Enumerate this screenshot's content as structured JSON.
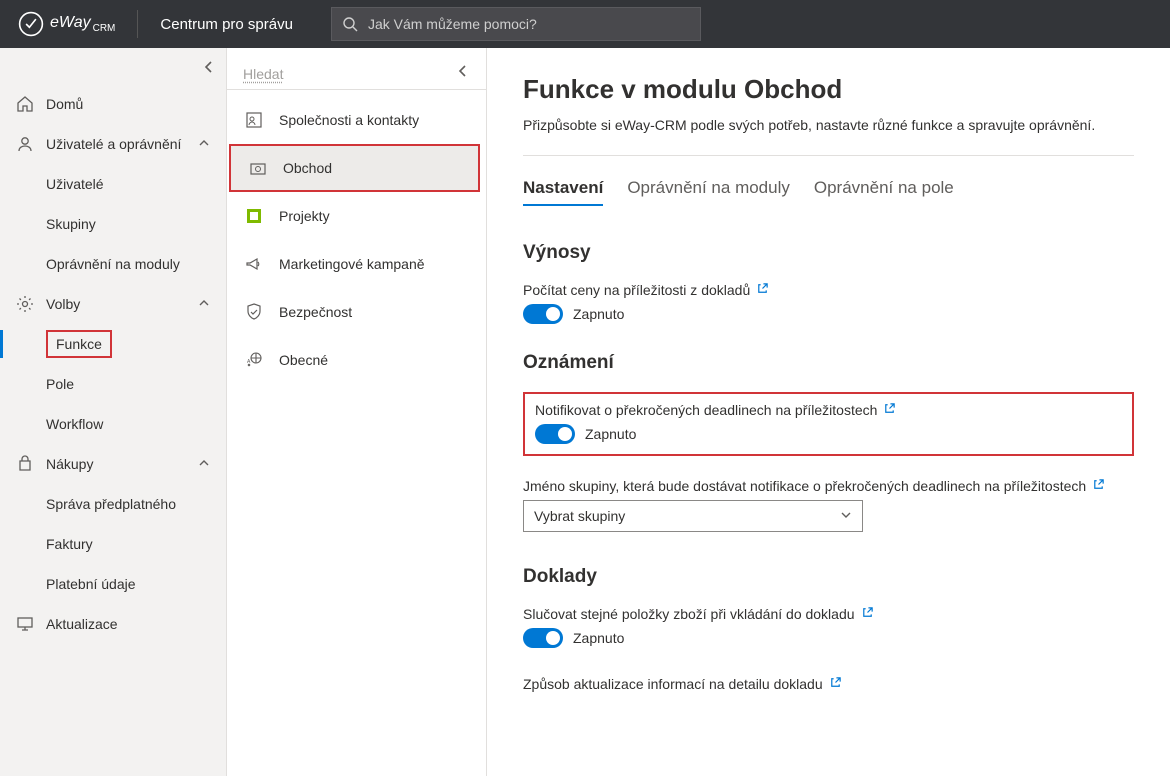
{
  "header": {
    "brand": "eWay",
    "brand_sub": "CRM",
    "title": "Centrum pro správu",
    "search_placeholder": "Jak Vám můžeme pomoci?"
  },
  "sidebar1": {
    "home": "Domů",
    "users_perm": "Uživatelé a oprávnění",
    "users": "Uživatelé",
    "groups": "Skupiny",
    "mod_perm": "Oprávnění na moduly",
    "options": "Volby",
    "features": "Funkce",
    "fields": "Pole",
    "workflow": "Workflow",
    "purchases": "Nákupy",
    "subscription": "Správa předplatného",
    "invoices": "Faktury",
    "payment": "Platební údaje",
    "updates": "Aktualizace"
  },
  "sidebar2": {
    "search_label": "Hledat",
    "items": [
      "Společnosti a kontakty",
      "Obchod",
      "Projekty",
      "Marketingové kampaně",
      "Bezpečnost",
      "Obecné"
    ]
  },
  "content": {
    "title": "Funkce v modulu Obchod",
    "subtitle": "Přizpůsobte si eWay-CRM podle svých potřeb, nastavte různé funkce a spravujte oprávnění.",
    "tabs": [
      "Nastavení",
      "Oprávnění na moduly",
      "Oprávnění na pole"
    ],
    "sec_revenues": "Výnosy",
    "setting_prices": "Počítat ceny na příležitosti z dokladů",
    "state_on": "Zapnuto",
    "sec_notifications": "Oznámení",
    "setting_notify": "Notifikovat o překročených deadlinech na příležitostech",
    "setting_group_label": "Jméno skupiny, která bude dostávat notifikace o překročených deadlinech na příležitostech",
    "select_placeholder": "Vybrat skupiny",
    "sec_docs": "Doklady",
    "setting_merge": "Slučovat stejné položky zboží při vkládání do dokladu",
    "setting_update": "Způsob aktualizace informací na detailu dokladu"
  }
}
